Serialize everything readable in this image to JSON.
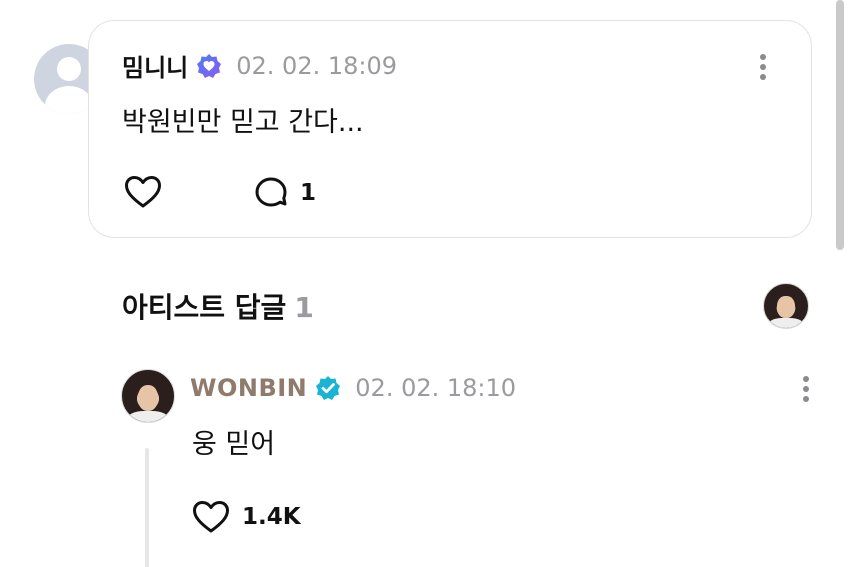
{
  "comment": {
    "username": "밈니니",
    "timestamp": "02. 02. 18:09",
    "text": "박원빈만 믿고 간다...",
    "reply_count": "1"
  },
  "artist_section": {
    "title": "아티스트 답글",
    "count": "1"
  },
  "artist_reply": {
    "username": "WONBIN",
    "timestamp": "02. 02. 18:10",
    "text": "웅 믿어",
    "like_count": "1.4K"
  },
  "colors": {
    "artist_name": "#8f7b6c",
    "verified_badge": "#19b4d4",
    "user_badge": "#5b6cf0",
    "timestamp": "#9a9a9f"
  },
  "icons": [
    "more-vertical-icon",
    "heart-icon",
    "comment-bubble-icon",
    "verified-badge-icon",
    "user-badge-icon"
  ]
}
